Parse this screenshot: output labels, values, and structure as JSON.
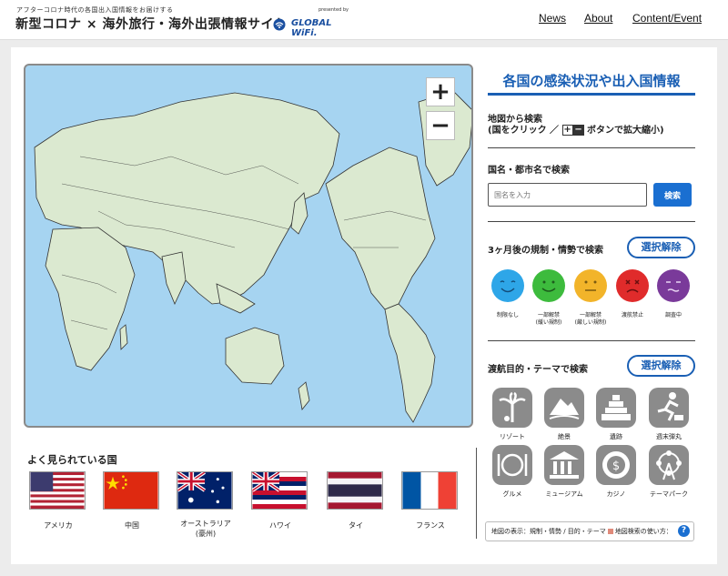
{
  "header": {
    "tagline": "アフターコロナ時代の各国出入国情報をお届けする",
    "site_title": "新型コロナ × 海外旅行・海外出張情報サイト",
    "presented_by": "presented by",
    "brand": "GLOBAL WiFi.",
    "nav": [
      {
        "label": "News"
      },
      {
        "label": "About"
      },
      {
        "label": "Content/Event"
      }
    ]
  },
  "map": {
    "zoom_in": "+",
    "zoom_out": "−",
    "ocean_color": "#a6d4f1",
    "land_color": "#dbe9d0"
  },
  "popular": {
    "title": "よく見られている国",
    "countries": [
      {
        "label": "アメリカ"
      },
      {
        "label": "中国"
      },
      {
        "label": "オーストラリア",
        "sub": "(豪州)"
      },
      {
        "label": "ハワイ"
      },
      {
        "label": "タイ"
      },
      {
        "label": "フランス"
      }
    ]
  },
  "panel": {
    "title": "各国の感染状況や出入国情報",
    "map_search": {
      "line1": "地図から検索",
      "line2_prefix": "(国をクリック ／",
      "line2_suffix": "ボタンで拡大縮小)",
      "plus": "+",
      "minus": "−"
    },
    "name_search": {
      "label": "国名・都市名で検索",
      "placeholder": "国名を入力",
      "button": "検索"
    },
    "restriction": {
      "label": "3ヶ月後の規制・情勢で検索",
      "clear": "選択解除",
      "items": [
        {
          "line1": "制限なし",
          "line2": "",
          "color": "#2ea6e8"
        },
        {
          "line1": "一部解禁",
          "line2": "(緩い規制)",
          "color": "#3dbb3d"
        },
        {
          "line1": "一部解禁",
          "line2": "(厳しい規制)",
          "color": "#f2b42a"
        },
        {
          "line1": "渡航禁止",
          "line2": "",
          "color": "#e02b2b"
        },
        {
          "line1": "調査中",
          "line2": "",
          "color": "#7a3a9a"
        }
      ]
    },
    "theme": {
      "label": "渡航目的・テーマで検索",
      "clear": "選択解除",
      "items": [
        {
          "label": "リゾート",
          "icon": "palm-tree-icon"
        },
        {
          "label": "絶景",
          "icon": "mountain-icon"
        },
        {
          "label": "遺跡",
          "icon": "pyramid-icon"
        },
        {
          "label": "週末弾丸",
          "icon": "runner-icon"
        },
        {
          "label": "グルメ",
          "icon": "dining-icon"
        },
        {
          "label": "ミュージアム",
          "icon": "museum-icon"
        },
        {
          "label": "カジノ",
          "icon": "casino-chip-icon"
        },
        {
          "label": "テーマパーク",
          "icon": "ferris-wheel-icon"
        }
      ]
    },
    "legend": {
      "text": "地図の表示：規制・情勢 / 目的・テーマ",
      "link": "地図検索の使い方：",
      "help": "?"
    }
  }
}
